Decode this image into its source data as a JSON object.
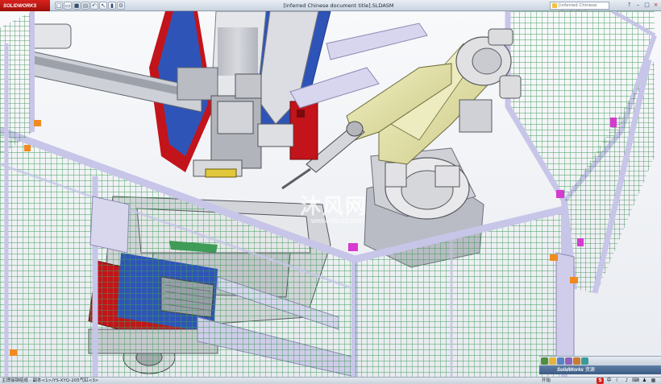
{
  "app": {
    "logo_brand": "SOLIDWORKS",
    "document_title": "[inferred Chinese document title].SLDASM",
    "search_placeholder": "[inferred Chinese placeholder]"
  },
  "quick_access": [
    {
      "icon": "new-icon"
    },
    {
      "icon": "open-icon"
    },
    {
      "icon": "save-icon"
    },
    {
      "icon": "print-icon"
    },
    {
      "icon": "undo-icon"
    },
    {
      "icon": "select-icon"
    },
    {
      "icon": "rebuild-icon"
    },
    {
      "icon": "options-icon"
    }
  ],
  "window_controls": [
    "help-icon",
    "minimize-icon",
    "maximize-icon",
    "close-icon"
  ],
  "watermark": {
    "main": "沐风网",
    "sub": "www.mfcad.com"
  },
  "task_pane": {
    "title_brand": "SolidWorks",
    "title_suffix": "资源",
    "subtitle": "开始"
  },
  "status_bar": {
    "left": "主焊接钢组成 - 副本<1>/YS-XYQ-205气缸<3>",
    "tray_input_method": "S",
    "tray_lang": "中",
    "tray_items": [
      "moon-icon",
      "mic-icon",
      "keyboard-icon",
      "shirt-icon",
      "grid-icon"
    ]
  },
  "colors": {
    "titlebar_top": "#e9eef5",
    "titlebar_bottom": "#c9d3df",
    "logo_red": "#d7221d",
    "viewport_bg": "#ffffff",
    "frame_lilac": "#c7c5e8",
    "mesh_green": "#3e9c57",
    "robot_yellow": "#e7e6a8",
    "table_blue": "#2f54b8",
    "accent_red": "#c2141a",
    "orange_bolt": "#f08a20",
    "magenta_bracket": "#d63ad0"
  }
}
